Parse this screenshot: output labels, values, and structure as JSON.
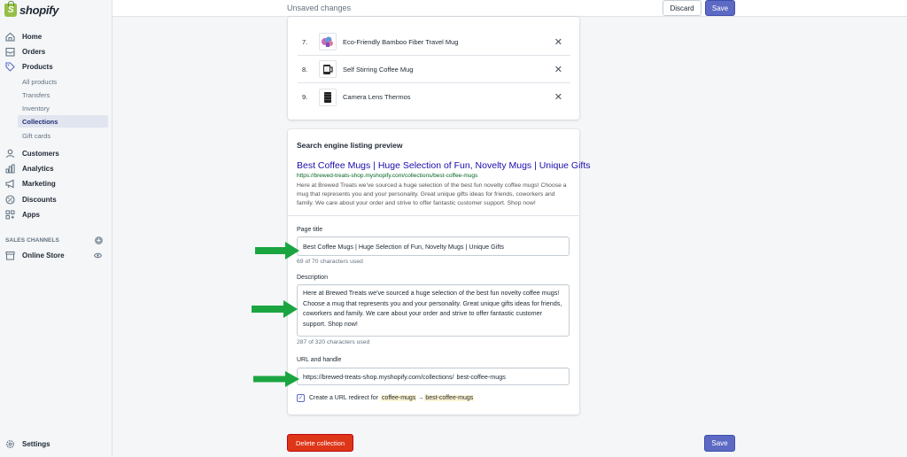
{
  "brand": {
    "logo_text": "shopify",
    "logo_letter": "S"
  },
  "sidebar": {
    "nav": [
      {
        "label": "Home",
        "icon": "home-icon"
      },
      {
        "label": "Orders",
        "icon": "orders-icon"
      },
      {
        "label": "Products",
        "icon": "tag-icon"
      }
    ],
    "products_sub": [
      "All products",
      "Transfers",
      "Inventory",
      "Collections",
      "Gift cards"
    ],
    "active_sub": "Collections",
    "nav2": [
      {
        "label": "Customers",
        "icon": "customers-icon"
      },
      {
        "label": "Analytics",
        "icon": "analytics-icon"
      },
      {
        "label": "Marketing",
        "icon": "marketing-icon"
      },
      {
        "label": "Discounts",
        "icon": "discounts-icon"
      },
      {
        "label": "Apps",
        "icon": "apps-icon"
      }
    ],
    "sales_channels_label": "SALES CHANNELS",
    "online_store_label": "Online Store",
    "settings_label": "Settings"
  },
  "topbar": {
    "title": "Unsaved changes",
    "discard_label": "Discard",
    "save_label": "Save"
  },
  "products": [
    {
      "num": "7.",
      "name": "Eco-Friendly Bamboo Fiber Travel Mug"
    },
    {
      "num": "8.",
      "name": "Self Stirring Coffee Mug"
    },
    {
      "num": "9.",
      "name": "Camera Lens Thermos"
    }
  ],
  "seo": {
    "heading": "Search engine listing preview",
    "preview_title": "Best Coffee Mugs | Huge Selection of Fun, Novelty Mugs | Unique Gifts",
    "preview_url": "https://brewed-treats-shop.myshopify.com/collections/best-coffee-mugs",
    "preview_desc": "Here at Brewed Treats we've sourced a huge selection of the best fun novelty coffee mugs! Choose a mug that represents you and your personality. Great unique gifts ideas for friends, coworkers and family. We care about your order and strive to offer fantastic customer support. Shop now!",
    "page_title_label": "Page title",
    "page_title_value": "Best Coffee Mugs | Huge Selection of Fun, Novelty Mugs | Unique Gifts",
    "page_title_count": "69 of 70 characters used",
    "description_label": "Description",
    "description_value": "Here at Brewed Treats we've sourced a huge selection of the best fun novelty coffee mugs! Choose a mug that represents you and your personality. Great unique gifts ideas for friends, coworkers and family. We care about your order and strive to offer fantastic customer support. Shop now!",
    "description_count": "287 of 320 characters used",
    "url_label": "URL and handle",
    "url_prefix": "https://brewed-treats-shop.myshopify.com/collections/",
    "url_handle": "best-coffee-mugs",
    "redirect_text": "Create a URL redirect for",
    "redirect_from": "coffee-mugs",
    "redirect_arrow": "→",
    "redirect_to": "best-coffee-mugs",
    "redirect_checked": true
  },
  "footer": {
    "delete_label": "Delete collection",
    "save_label": "Save"
  },
  "colors": {
    "accent": "#5c6ac4",
    "danger": "#de3618",
    "arrow": "#1aa541",
    "brand_green": "#95bf47"
  }
}
